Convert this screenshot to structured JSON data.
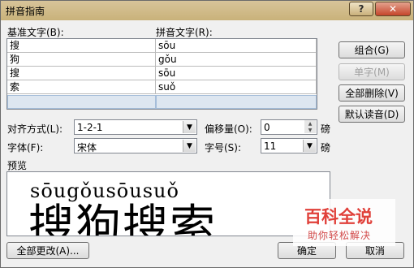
{
  "window": {
    "title": "拼音指南"
  },
  "titlebar": {
    "help_icon": "help-icon",
    "close_icon": "close-icon",
    "help_glyph": "?",
    "close_glyph": "✕"
  },
  "labels": {
    "base_text": "基准文字(B):",
    "ruby_text": "拼音文字(R):"
  },
  "rows": [
    {
      "base": "搜",
      "ruby": "sōu"
    },
    {
      "base": "狗",
      "ruby": "gǒu"
    },
    {
      "base": "搜",
      "ruby": "sōu"
    },
    {
      "base": "索",
      "ruby": "suǒ"
    },
    {
      "base": "",
      "ruby": ""
    }
  ],
  "buttons": {
    "group": "组合(G)",
    "single": "单字(M)",
    "clear_all": "全部删除(V)",
    "default_reading": "默认读音(D)",
    "change_all": "全部更改(A)...",
    "ok": "确定",
    "cancel": "取消"
  },
  "options": {
    "alignment_label": "对齐方式(L):",
    "alignment_value": "1-2-1",
    "offset_label": "偏移量(O):",
    "offset_value": "0",
    "offset_unit": "磅",
    "font_label": "字体(F):",
    "font_value": "宋体",
    "size_label": "字号(S):",
    "size_value": "11",
    "size_unit": "磅"
  },
  "preview": {
    "label": "预览",
    "pinyin": "sōugǒusōusuǒ",
    "chars": "搜狗搜索"
  },
  "watermark": {
    "logo": "百科全说",
    "sub": "助你轻松解决"
  }
}
